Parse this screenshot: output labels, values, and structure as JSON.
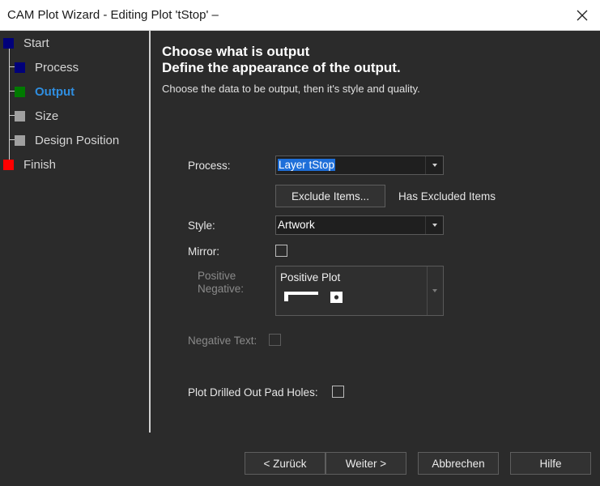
{
  "window": {
    "title": "CAM Plot Wizard - Editing Plot 'tStop' –"
  },
  "steps": [
    {
      "label": "Start",
      "color": "#00007a"
    },
    {
      "label": "Process",
      "color": "#00007a"
    },
    {
      "label": "Output",
      "color": "#007a00",
      "active": true
    },
    {
      "label": "Size",
      "color": "#a0a0a0"
    },
    {
      "label": "Design Position",
      "color": "#a0a0a0"
    },
    {
      "label": "Finish",
      "color": "#ff0000"
    }
  ],
  "page": {
    "heading_line1": "Choose what is output",
    "heading_line2": "Define the appearance of the output.",
    "subtitle": "Choose the data to be output, then it's style and quality."
  },
  "form": {
    "process_label": "Process:",
    "process_value": "Layer tStop",
    "exclude_button": "Exclude Items...",
    "excluded_status": "Has Excluded Items",
    "style_label": "Style:",
    "style_value": "Artwork",
    "mirror_label": "Mirror:",
    "mirror_checked": false,
    "positive_label": "Positive",
    "negative_label": "Negative:",
    "polarity_value": "Positive Plot",
    "negative_text_label": "Negative Text:",
    "negative_text_checked": false,
    "drilled_label": "Plot Drilled Out Pad Holes:",
    "drilled_checked": false
  },
  "buttons": {
    "back": "< Zurück",
    "next": "Weiter >",
    "cancel": "Abbrechen",
    "help": "Hilfe"
  },
  "colors": {
    "accent": "#2f8ee0",
    "selection": "#1e6fd9",
    "background": "#2b2b2b"
  }
}
